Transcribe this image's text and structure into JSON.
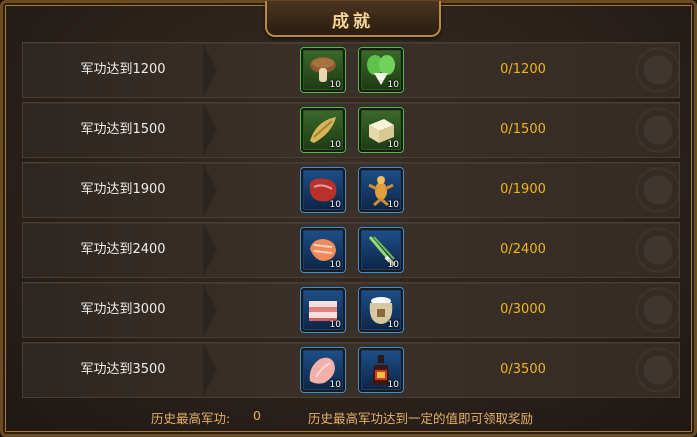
{
  "title": "成就",
  "rows": [
    {
      "condition": "军功达到1200",
      "progress": "0/1200",
      "rewards": [
        {
          "icon": "mushroom-icon",
          "quality": "green",
          "qty": "10"
        },
        {
          "icon": "bok-choy-icon",
          "quality": "green",
          "qty": "10"
        }
      ]
    },
    {
      "condition": "军功达到1500",
      "progress": "0/1500",
      "rewards": [
        {
          "icon": "bamboo-shoot-icon",
          "quality": "green",
          "qty": "10"
        },
        {
          "icon": "tofu-icon",
          "quality": "green",
          "qty": "10"
        }
      ]
    },
    {
      "condition": "军功达到1900",
      "progress": "0/1900",
      "rewards": [
        {
          "icon": "meat-icon",
          "quality": "blue",
          "qty": "10"
        },
        {
          "icon": "ginseng-icon",
          "quality": "blue",
          "qty": "10"
        }
      ]
    },
    {
      "condition": "军功达到2400",
      "progress": "0/2400",
      "rewards": [
        {
          "icon": "salmon-steak-icon",
          "quality": "blue",
          "qty": "10"
        },
        {
          "icon": "scallion-icon",
          "quality": "blue",
          "qty": "10"
        }
      ]
    },
    {
      "condition": "军功达到3000",
      "progress": "0/3000",
      "rewards": [
        {
          "icon": "pork-belly-icon",
          "quality": "blue",
          "qty": "10"
        },
        {
          "icon": "flour-sack-icon",
          "quality": "blue",
          "qty": "10"
        }
      ]
    },
    {
      "condition": "军功达到3500",
      "progress": "0/3500",
      "rewards": [
        {
          "icon": "chicken-breast-icon",
          "quality": "blue",
          "qty": "10"
        },
        {
          "icon": "soy-sauce-bottle-icon",
          "quality": "blue",
          "qty": "10"
        }
      ]
    }
  ],
  "footer": {
    "history_label": "历史最高军功:",
    "history_value": "0",
    "tip": "历史最高军功达到一定的值即可领取奖励"
  },
  "colors": {
    "progress": "#f1b51c",
    "footer_text": "#e6b066",
    "title": "#f4d79b",
    "green_frame": "#4cbf3a",
    "blue_frame": "#3a8fd8"
  }
}
